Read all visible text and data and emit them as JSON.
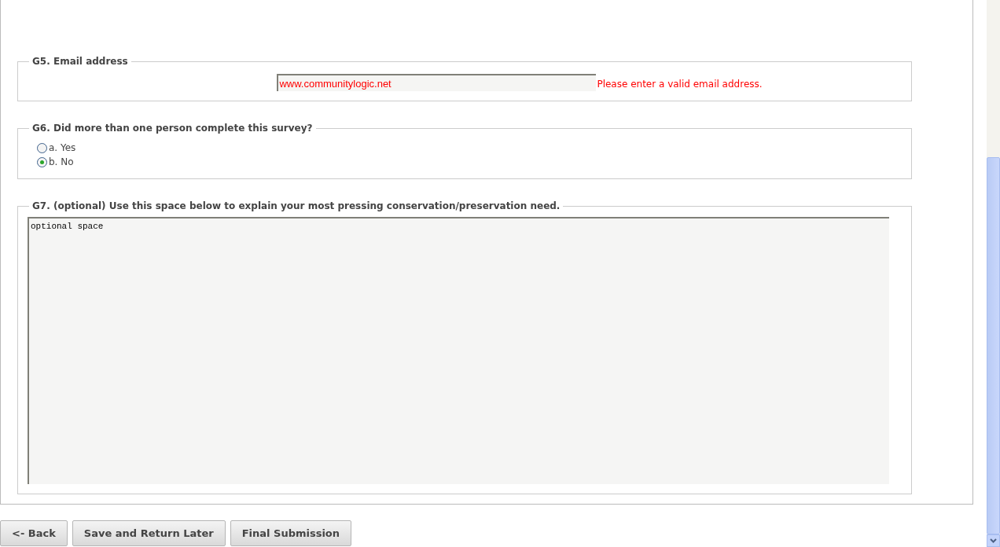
{
  "questions": [
    {
      "kind": "email",
      "legend": "G5. Email address",
      "value": "www.communitylogic.net",
      "error": "Please enter a valid email address."
    },
    {
      "kind": "radio",
      "legend": "G6. Did more than one person complete this survey?",
      "options": [
        {
          "label": "a. Yes",
          "selected": false
        },
        {
          "label": "b. No",
          "selected": true
        }
      ]
    },
    {
      "kind": "textarea",
      "legend": "G7. (optional) Use this space below to explain your most pressing conservation/preservation need.",
      "value": "optional space"
    }
  ],
  "buttons": [
    {
      "label": "<- Back"
    },
    {
      "label": "Save and Return Later"
    },
    {
      "label": "Final Submission"
    }
  ]
}
